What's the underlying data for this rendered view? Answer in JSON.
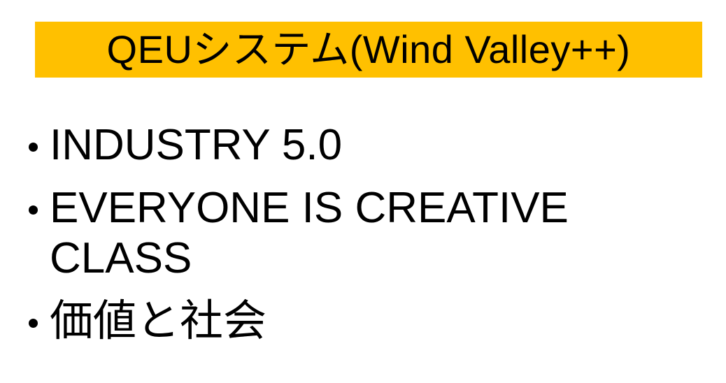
{
  "slide": {
    "title": "QEUシステム(Wind Valley++)",
    "title_bg_color": "#FFC000",
    "text_color": "#000000",
    "background_color": "#FFFFFF",
    "bullets": [
      {
        "text": "INDUSTRY 5.0"
      },
      {
        "text": "EVERYONE IS CREATIVE CLASS"
      },
      {
        "text": "価値と社会"
      }
    ]
  }
}
